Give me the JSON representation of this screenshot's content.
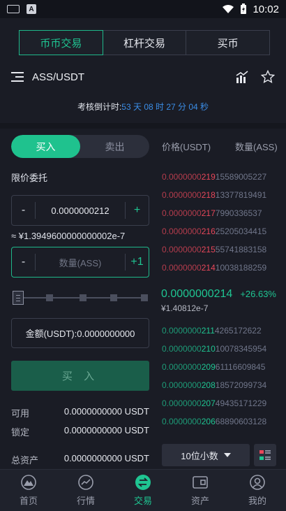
{
  "status": {
    "time": "10:02"
  },
  "top_tabs": [
    "币币交易",
    "杠杆交易",
    "买币"
  ],
  "header": {
    "pair": "ASS/USDT"
  },
  "countdown": {
    "label": "考核倒计时:",
    "value": "53 天 08 时 27 分 04 秒"
  },
  "trade": {
    "buy_tab": "买入",
    "sell_tab": "卖出",
    "order_type": "限价委托",
    "price_value": "0.0000000212",
    "approx": "≈ ¥1.3949600000000002e-7",
    "qty_placeholder": "数量(ASS)",
    "qty_plus": "+1",
    "amount": "金额(USDT):0.0000000000",
    "buy_button": "买 入",
    "slider_percent": 0,
    "available_label": "可用",
    "available_value": "0.0000000000 USDT",
    "locked_label": "锁定",
    "locked_value": "0.0000000000 USDT",
    "total_label": "总资产",
    "total_value": "0.0000000000 USDT"
  },
  "orderbook": {
    "price_header": "价格(USDT)",
    "qty_header": "数量(ASS)",
    "asks": [
      {
        "price_a": "0.0000000",
        "price_b": "219",
        "qty": "15589005227"
      },
      {
        "price_a": "0.0000000",
        "price_b": "218",
        "qty": "13377819491"
      },
      {
        "price_a": "0.0000000",
        "price_b": "217",
        "qty": "7990336537"
      },
      {
        "price_a": "0.0000000",
        "price_b": "216",
        "qty": "25205034415"
      },
      {
        "price_a": "0.0000000",
        "price_b": "215",
        "qty": "55741883158"
      },
      {
        "price_a": "0.0000000",
        "price_b": "214",
        "qty": "10038188259"
      }
    ],
    "last_price": "0.0000000214",
    "last_change": "+26.63%",
    "last_cny": "¥1.40812e-7",
    "bids": [
      {
        "price_a": "0.0000000",
        "price_b": "211",
        "qty": "4265172622"
      },
      {
        "price_a": "0.0000000",
        "price_b": "210",
        "qty": "10078345954"
      },
      {
        "price_a": "0.0000000",
        "price_b": "209",
        "qty": "61116609845"
      },
      {
        "price_a": "0.0000000",
        "price_b": "208",
        "qty": "18572099734"
      },
      {
        "price_a": "0.0000000",
        "price_b": "207",
        "qty": "49435171229"
      },
      {
        "price_a": "0.0000000",
        "price_b": "206",
        "qty": "68890603128"
      }
    ],
    "decimal_select": "10位小数"
  },
  "nav": [
    "首页",
    "行情",
    "交易",
    "资产",
    "我的"
  ],
  "colors": {
    "accent": "#1fc592",
    "ask": "#e8475a",
    "countdown": "#3b8de6"
  }
}
